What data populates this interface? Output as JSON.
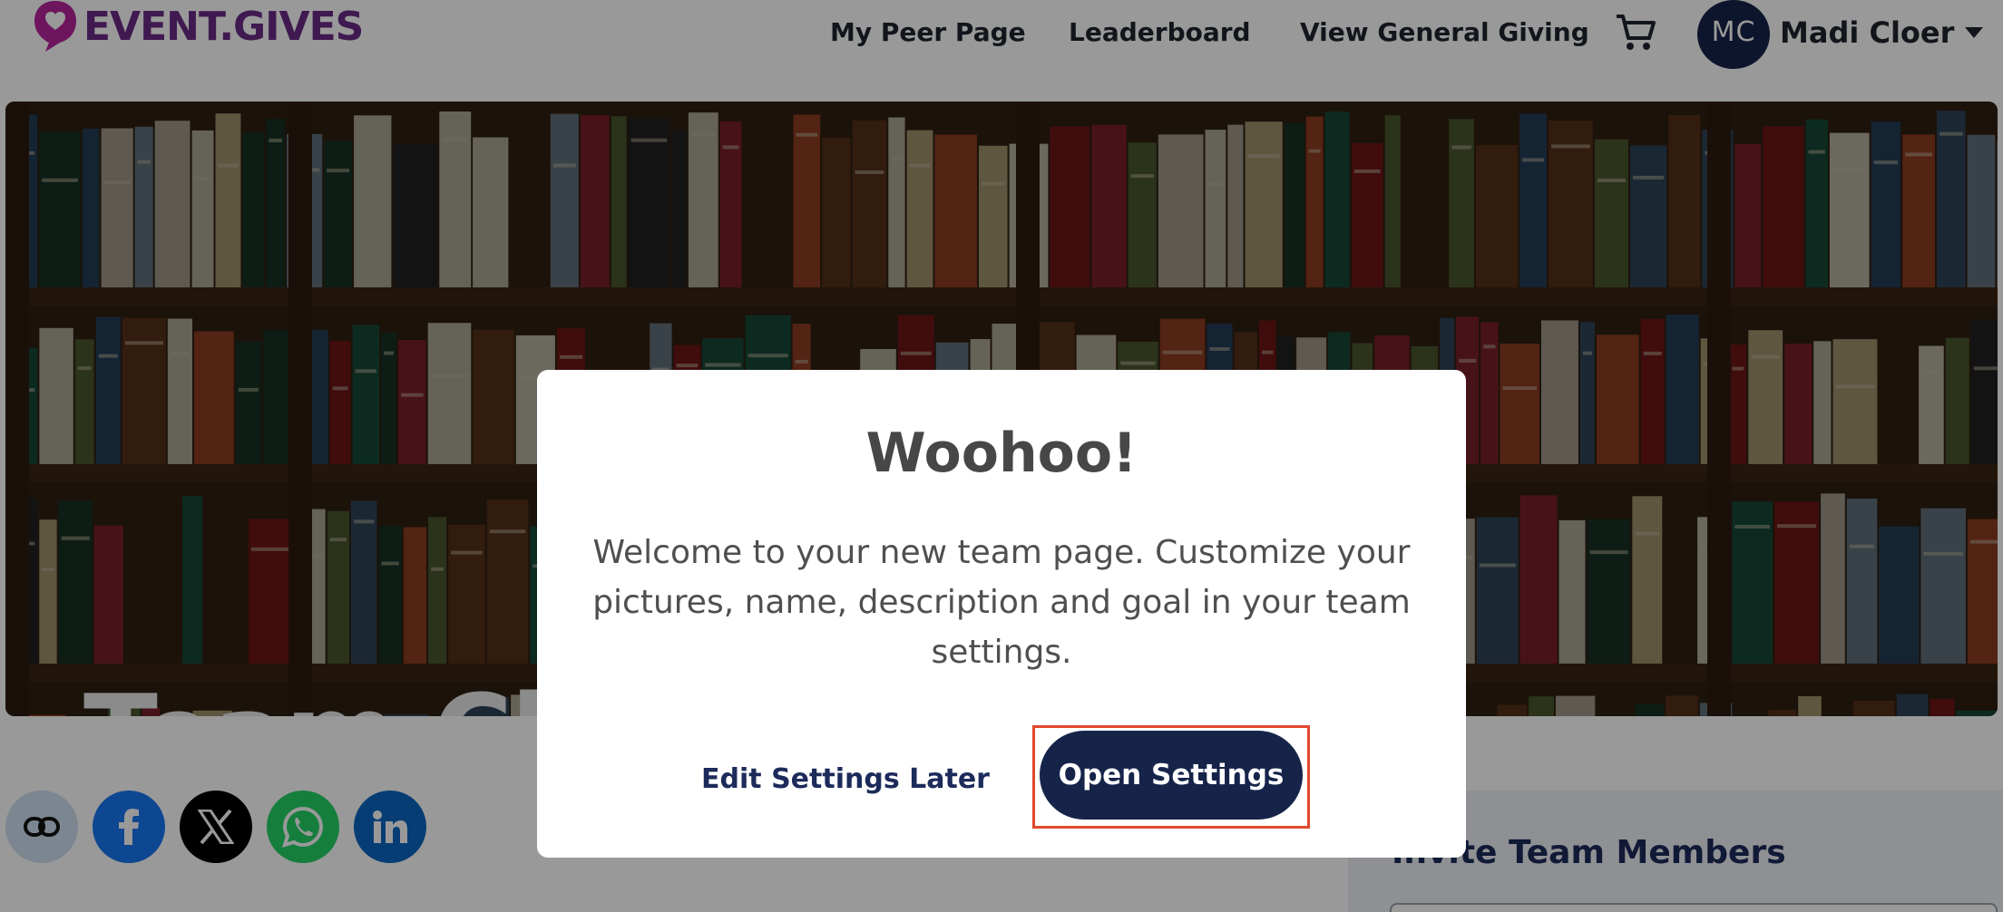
{
  "header": {
    "logo_text": "EVENT.GIVES",
    "nav": [
      "My Peer Page",
      "Leaderboard",
      "View General Giving"
    ],
    "cart_icon": "cart-icon",
    "user": {
      "initials": "MC",
      "name": "Madi Cloer"
    }
  },
  "hero": {
    "team_title": "Team Cl",
    "settings_icon": "gear-icon"
  },
  "share": {
    "icons": [
      "link-icon",
      "facebook-icon",
      "x-icon",
      "whatsapp-icon",
      "linkedin-icon"
    ]
  },
  "invite": {
    "title": "Invite Team Members"
  },
  "modal": {
    "title": "Woohoo!",
    "body": "Welcome to your new team page. Customize your pictures, name, description and goal in your team settings.",
    "secondary_button": "Edit Settings Later",
    "primary_button": "Open Settings"
  },
  "colors": {
    "brand_purple": "#6a2a86",
    "navy": "#16244a",
    "highlight": "#e0482d",
    "facebook": "#1877f2",
    "whatsapp": "#25d366",
    "linkedin": "#0a66c2"
  }
}
